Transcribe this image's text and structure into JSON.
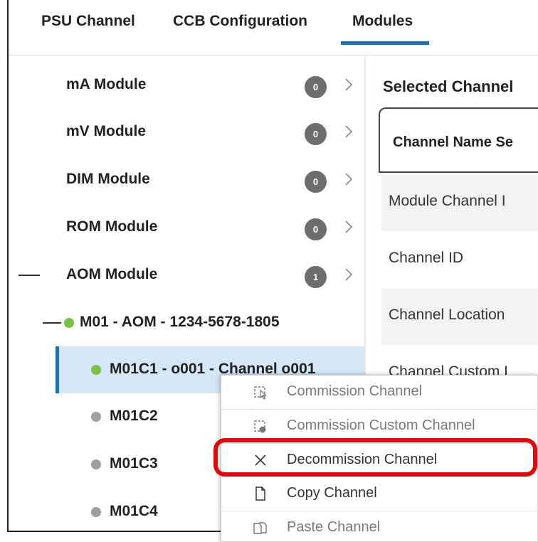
{
  "tabs": [
    {
      "label": "PSU Channel"
    },
    {
      "label": "CCB Configuration"
    },
    {
      "label": "Modules",
      "active": true
    }
  ],
  "tree": {
    "modules": [
      {
        "label": "mA Module",
        "count": "0"
      },
      {
        "label": "mV Module",
        "count": "0"
      },
      {
        "label": "DIM Module",
        "count": "0"
      },
      {
        "label": "ROM Module",
        "count": "0"
      },
      {
        "label": "AOM Module",
        "count": "1"
      }
    ],
    "device": {
      "label": "M01 - AOM - 1234-5678-1805",
      "status_color": "#7cc142"
    },
    "channels": [
      {
        "label": "M01C1 - o001 - Channel o001",
        "status_color": "#7cc142",
        "selected": true
      },
      {
        "label": "M01C2",
        "status_color": "#9e9e9e"
      },
      {
        "label": "M01C3",
        "status_color": "#9e9e9e"
      },
      {
        "label": "M01C4",
        "status_color": "#9e9e9e"
      }
    ]
  },
  "details": {
    "title": "Selected Channel",
    "header": "Channel Name Se",
    "fields": [
      "Module Channel I",
      "Channel ID",
      "Channel Location",
      "Channel Custom L"
    ]
  },
  "context_menu": {
    "items": [
      {
        "label": "Commission Channel",
        "icon": "commission-icon",
        "enabled": false
      },
      {
        "label": "Commission Custom Channel",
        "icon": "commission-custom-icon",
        "enabled": false
      },
      {
        "label": "Decommission Channel",
        "icon": "close-icon",
        "enabled": true,
        "highlighted": true
      },
      {
        "label": "Copy Channel",
        "icon": "copy-icon",
        "enabled": true
      },
      {
        "label": "Paste Channel",
        "icon": "paste-icon",
        "enabled": false
      }
    ]
  },
  "colors": {
    "accent": "#1f6fb2",
    "selected_bg": "#d5e6f6",
    "highlight": "#e10a0a",
    "badge": "#6d6d6d"
  }
}
